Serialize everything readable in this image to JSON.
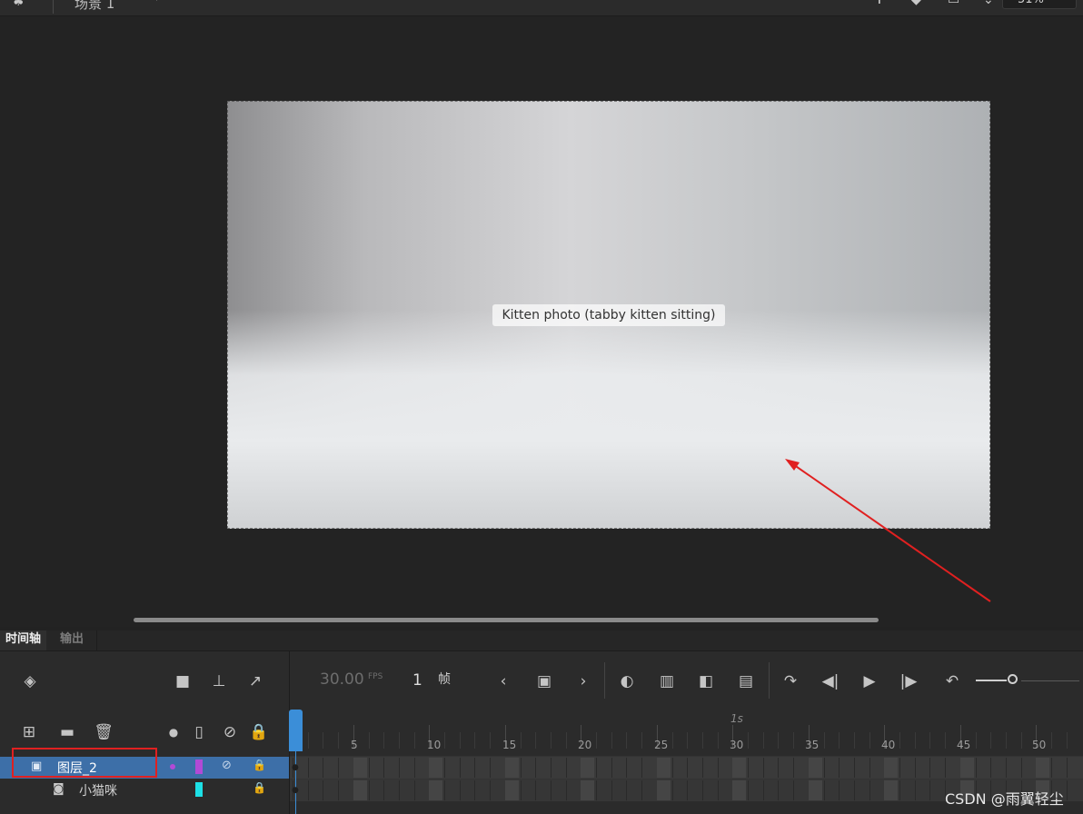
{
  "topbar": {
    "scene_label": "场景 1",
    "zoom_value": "51%",
    "icons": [
      "scene-icon",
      "move-icon",
      "paint-bucket-icon",
      "stage-size-icon",
      "chevron-down-icon"
    ]
  },
  "stage": {
    "image_label": "Kitten photo (tabby kitten sitting)"
  },
  "timeline": {
    "tabs": [
      "时间轴",
      "输出"
    ],
    "fps_value": "30.00",
    "fps_unit": "FPS",
    "current_frame": "1",
    "frame_unit": "帧",
    "ruler_seconds_label": "1s",
    "tick_labels": [
      "5",
      "10",
      "15",
      "20",
      "25",
      "30",
      "35",
      "40",
      "45",
      "50"
    ],
    "layers": [
      {
        "name": "图层_2",
        "color": "#b24ad6",
        "selected": true
      },
      {
        "name": "小猫咪",
        "color": "#1de0e6",
        "selected": false
      }
    ]
  },
  "watermark": "CSDN @雨翼轻尘",
  "colors": {
    "accent": "#3b8ed8",
    "selected_layer": "#3d6fa8",
    "annotation_red": "#e02020"
  }
}
